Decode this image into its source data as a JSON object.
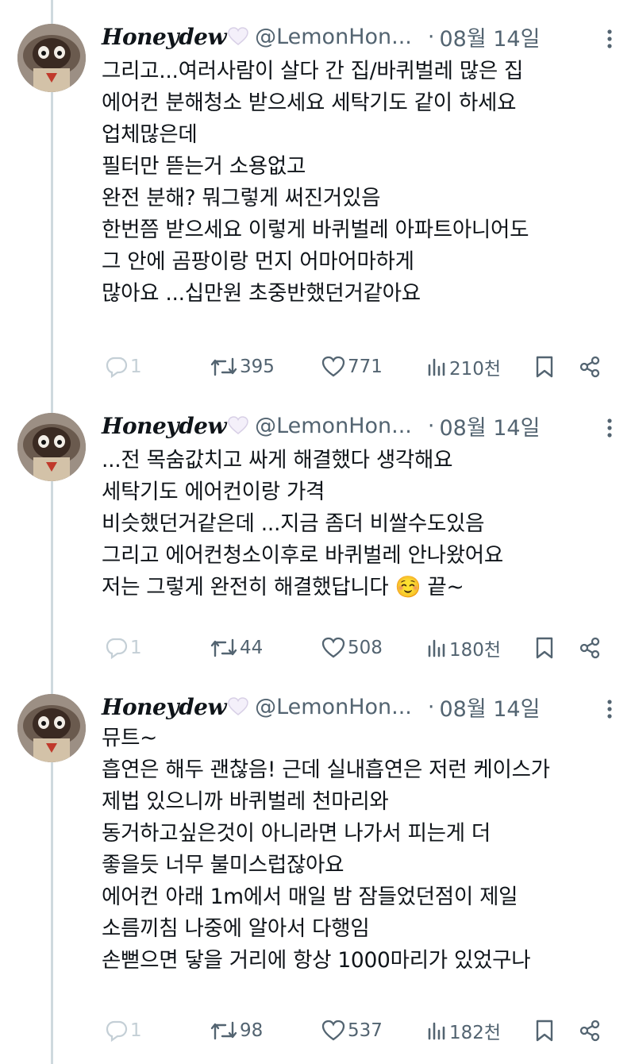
{
  "tweets": [
    {
      "display_name": "Honeydew",
      "handle": "@LemonHon...",
      "date": "08월 14일",
      "lines": [
        "그리고...여러사람이 살다 간 집/바퀴벌레 많은 집",
        "에어컨 분해청소 받으세요 세탁기도 같이 하세요",
        "업체많은데",
        "필터만 뜯는거 소용없고",
        "완전 분해? 뭐그렇게 써진거있음",
        "한번쯤 받으세요 이렇게 바퀴벌레 아파트아니어도",
        "그 안에 곰팡이랑 먼지 어마어마하게",
        "많아요 ...십만원 초중반했던거같아요"
      ],
      "replies": "1",
      "retweets": "395",
      "likes": "771",
      "views": "210천"
    },
    {
      "display_name": "Honeydew",
      "handle": "@LemonHon...",
      "date": "08월 14일",
      "lines": [
        "...전 목숨값치고 싸게 해결했다 생각해요",
        "세탁기도 에어컨이랑 가격",
        "비슷했던거같은데 ...지금 좀더 비쌀수도있음",
        "그리고 에어컨청소이후로 바퀴벌레 안나왔어요",
        "저는 그렇게 완전히 해결했답니다 ☺️ 끝~"
      ],
      "replies": "1",
      "retweets": "44",
      "likes": "508",
      "views": "180천"
    },
    {
      "display_name": "Honeydew",
      "handle": "@LemonHon...",
      "date": "08월 14일",
      "lines": [
        "뮤트~",
        "흡연은 해두 괜찮음! 근데 실내흡연은 저런 케이스가",
        "제법 있으니까 바퀴벌레 천마리와",
        "동거하고싶은것이 아니라면 나가서 피는게 더",
        "좋을듯 너무 불미스럽잖아요",
        "에어컨 아래 1m에서 매일 밤 잠들었던점이 제일",
        "소름끼침 나중에 알아서 다행임",
        "손뻗으면 닿을 거리에 항상 1000마리가 있었구나"
      ],
      "replies": "1",
      "retweets": "98",
      "likes": "537",
      "views": "182천"
    }
  ],
  "icons": {
    "verified_heart": "white-heart-icon",
    "more": "more-vertical-icon",
    "reply": "reply-icon",
    "retweet": "retweet-icon",
    "like": "heart-icon",
    "views": "views-icon",
    "bookmark": "bookmark-icon",
    "share": "share-icon"
  },
  "colors": {
    "text": "#0f1419",
    "secondary": "#536471",
    "reply_faint": "#c4cfd6",
    "thread_line": "#cfd9de"
  }
}
